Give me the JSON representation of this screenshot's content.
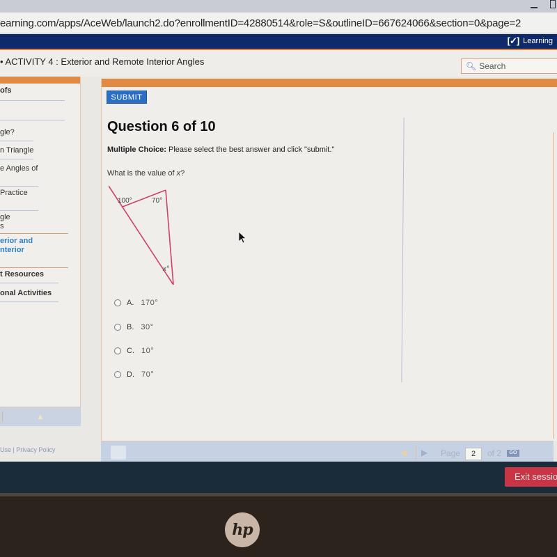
{
  "browser": {
    "url": "earning.com/apps/AceWeb/launch2.do?enrollmentID=42880514&role=S&outlineID=667624066&section=0&page=2"
  },
  "brand": {
    "logo_text": "Learning",
    "brand_color": "#0f2a6a",
    "accent_color": "#e08a43"
  },
  "activity": {
    "title": "• ACTIVITY 4 : Exterior and Remote Interior Angles"
  },
  "search": {
    "placeholder": "Search"
  },
  "sidebar": {
    "items": [
      {
        "label": "ofs",
        "bold": true
      },
      {
        "label": "gle?"
      },
      {
        "label": "n Triangle"
      },
      {
        "label": "e Angles of"
      },
      {
        "label": "Practice"
      },
      {
        "label": "gle\ns"
      },
      {
        "label": "erior and\nnterior",
        "active": true
      },
      {
        "label": "t Resources",
        "bold": true
      },
      {
        "label": "onal Activities",
        "bold": true
      }
    ]
  },
  "footer": {
    "links": "Use  |  Privacy Policy"
  },
  "question": {
    "submit_label": "SUBMIT",
    "title": "Question 6 of 10",
    "instruction_type": "Multiple Choice:",
    "instruction_text": " Please select the best answer and click \"submit.\"",
    "prompt_pre": "What is the value of ",
    "prompt_var": "x",
    "prompt_post": "?",
    "diagram": {
      "exterior_angle_label": "100°",
      "interior_angle_label": "70°",
      "unknown_label": "x°",
      "line_color": "#cc4466"
    },
    "answers": [
      {
        "letter": "A.",
        "value": "170°"
      },
      {
        "letter": "B.",
        "value": "30°"
      },
      {
        "letter": "C.",
        "value": "10°"
      },
      {
        "letter": "D.",
        "value": "70°"
      }
    ]
  },
  "pager": {
    "page_label": "Page",
    "current_page": "2",
    "of_label": "of 2",
    "go_label": "GO"
  },
  "taskbar": {
    "exit_label": "Exit session"
  },
  "hardware": {
    "logo": "hp"
  }
}
